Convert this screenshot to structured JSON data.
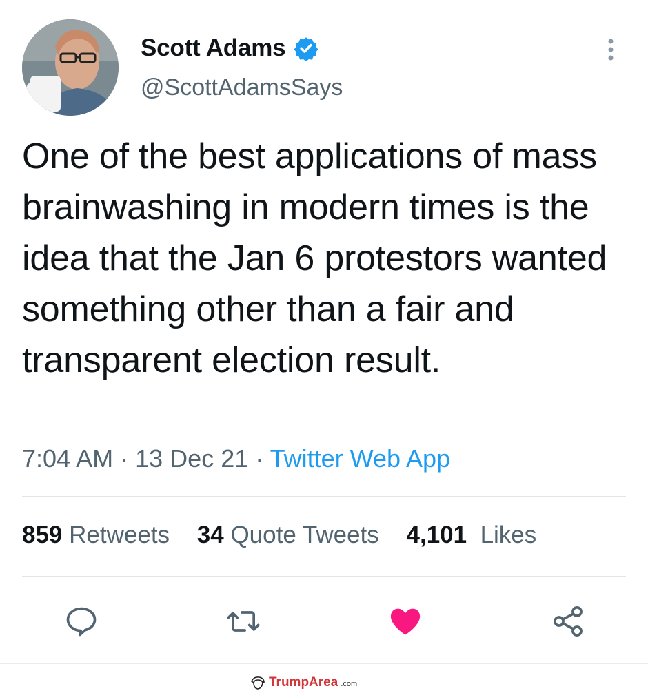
{
  "author": {
    "display_name": "Scott Adams",
    "handle": "@ScottAdamsSays",
    "verified": true
  },
  "tweet": {
    "text": "One of the best applications of mass brainwashing in modern times is the idea that the Jan 6 protestors wanted something other than a fair and transparent election result.",
    "time": "7:04 AM",
    "date": "13 Dec 21",
    "source": "Twitter Web App",
    "separator": "·"
  },
  "stats": {
    "retweets_count": "859",
    "retweets_label": "Retweets",
    "quote_count": "34",
    "quote_label": "Quote Tweets",
    "likes_count": "4,101",
    "likes_label": "Likes"
  },
  "actions": [
    "reply-icon",
    "retweet-icon",
    "like-icon",
    "share-icon"
  ],
  "colors": {
    "verified": "#1d9bf0",
    "link": "#1d9bf0",
    "like": "#f91880",
    "muted": "#536471"
  },
  "watermark": {
    "brand": "TrumpArea",
    "suffix": ".com"
  }
}
